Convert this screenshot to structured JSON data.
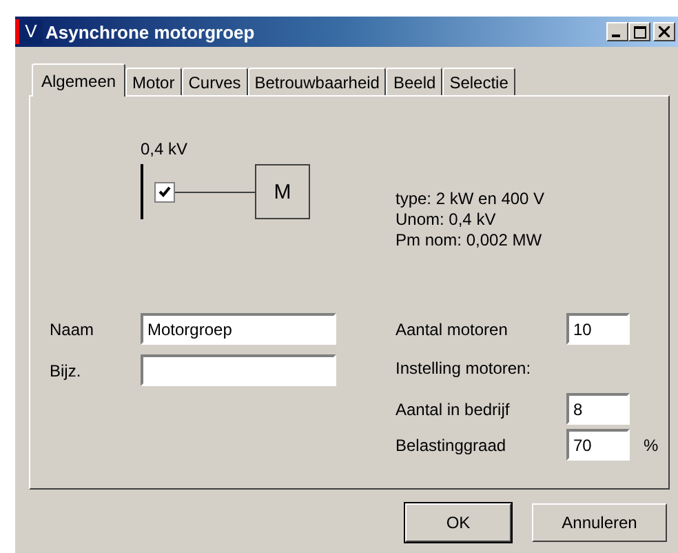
{
  "window": {
    "icon_letter": "V",
    "title": "Asynchrone motorgroep"
  },
  "tabs": [
    {
      "label": "Algemeen",
      "selected": true
    },
    {
      "label": "Motor",
      "selected": false
    },
    {
      "label": "Curves",
      "selected": false
    },
    {
      "label": "Betrouwbaarheid",
      "selected": false
    },
    {
      "label": "Beeld",
      "selected": false
    },
    {
      "label": "Selectie",
      "selected": false
    }
  ],
  "diagram": {
    "voltage": "0,4 kV",
    "switch_checked": true,
    "motor_symbol": "M",
    "info": [
      "type: 2 kW en 400 V",
      "Unom: 0,4 kV",
      "Pm nom: 0,002 MW"
    ]
  },
  "left_fields": [
    {
      "label": "Naam",
      "value": "Motorgroep"
    },
    {
      "label": "Bijz."
    }
  ],
  "aantal_motoren": {
    "label": "Aantal motoren",
    "value": "10"
  },
  "instelling_heading": "Instelling motoren:",
  "settings": [
    {
      "label": "Aantal in bedrijf",
      "value": "8"
    },
    {
      "label": "Belastinggraad",
      "value": "70",
      "unit": "%"
    }
  ],
  "buttons": [
    {
      "label": "OK",
      "default": true
    },
    {
      "label": "Annuleren",
      "default": false
    }
  ]
}
